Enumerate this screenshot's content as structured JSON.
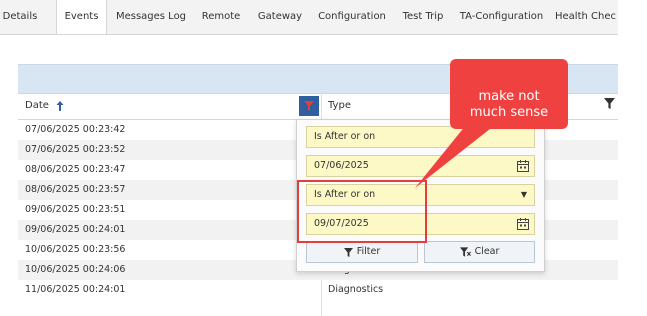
{
  "tabs": [
    {
      "label": "Details"
    },
    {
      "label": "Events"
    },
    {
      "label": "Messages Log"
    },
    {
      "label": "Remote"
    },
    {
      "label": "Gateway"
    },
    {
      "label": "Configuration"
    },
    {
      "label": "Test Trip"
    },
    {
      "label": "TA-Configuration"
    },
    {
      "label": "Health Chec"
    }
  ],
  "active_tab": "Events",
  "grid": {
    "columns": {
      "date": "Date",
      "type": "Type"
    },
    "rows": [
      {
        "date": "07/06/2025 00:23:42",
        "type": ""
      },
      {
        "date": "07/06/2025 00:23:52",
        "type": ""
      },
      {
        "date": "08/06/2025 00:23:47",
        "type": ""
      },
      {
        "date": "08/06/2025 00:23:57",
        "type": ""
      },
      {
        "date": "09/06/2025 00:23:51",
        "type": ""
      },
      {
        "date": "09/06/2025 00:24:01",
        "type": ""
      },
      {
        "date": "10/06/2025 00:23:56",
        "type": ""
      },
      {
        "date": "10/06/2025 00:24:06",
        "type": "Diagnostics"
      },
      {
        "date": "11/06/2025 00:24:01",
        "type": "Diagnostics"
      }
    ]
  },
  "filter_popup": {
    "operator1": "Is After or on",
    "value1": "07/06/2025",
    "operator2": "Is After or on",
    "value2": "09/07/2025",
    "filter_label": "Filter",
    "clear_label": "Clear"
  },
  "annotation": {
    "line1": "make not",
    "line2": "much sense"
  },
  "colors": {
    "annotation": "#f04141",
    "filter_active": "#2f5f9e",
    "field_bg": "#fdf9c6"
  }
}
